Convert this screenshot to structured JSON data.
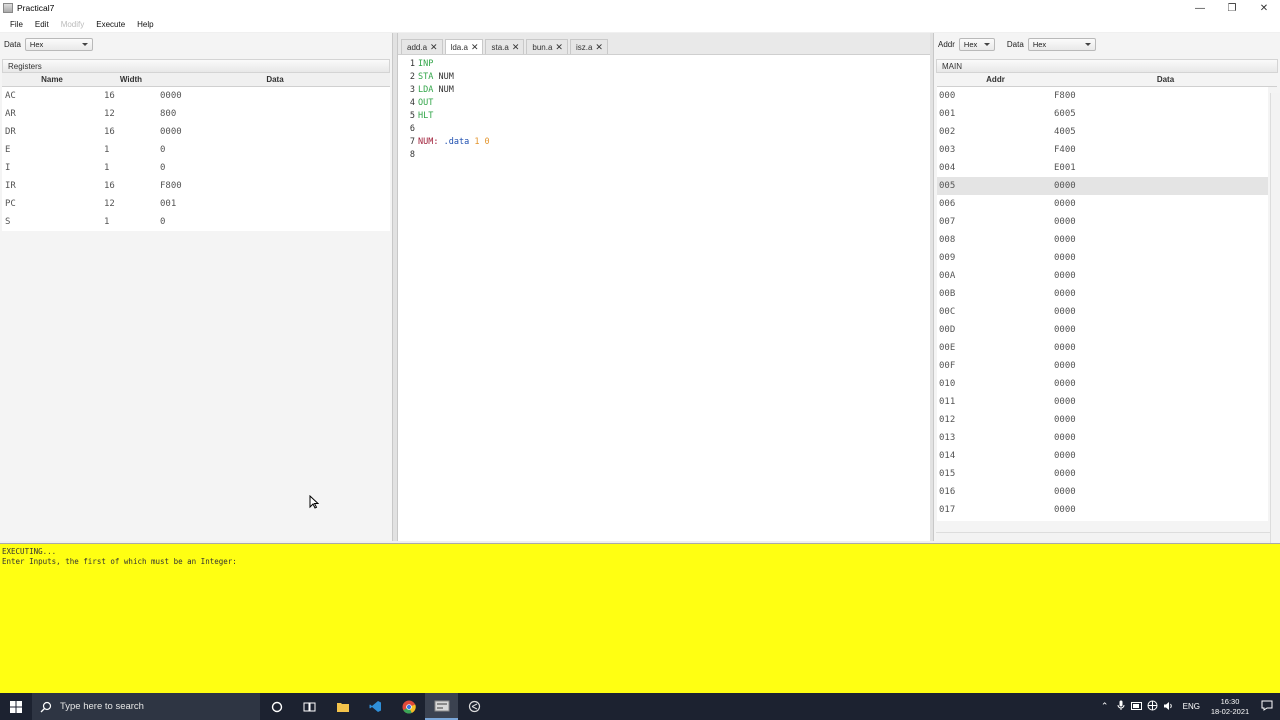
{
  "window": {
    "title": "Practical7",
    "controls": [
      "—",
      "❐",
      "✕"
    ]
  },
  "menu": [
    {
      "label": "File",
      "enabled": true
    },
    {
      "label": "Edit",
      "enabled": true
    },
    {
      "label": "Modify",
      "enabled": false
    },
    {
      "label": "Execute",
      "enabled": true
    },
    {
      "label": "Help",
      "enabled": true
    }
  ],
  "registers_panel": {
    "data_label": "Data",
    "data_format": "Hex",
    "section_title": "Registers",
    "columns": [
      "Name",
      "Width",
      "Data"
    ],
    "rows": [
      {
        "name": "AC",
        "width": "16",
        "data": "0000"
      },
      {
        "name": "AR",
        "width": "12",
        "data": "800"
      },
      {
        "name": "DR",
        "width": "16",
        "data": "0000"
      },
      {
        "name": "E",
        "width": "1",
        "data": "0"
      },
      {
        "name": "I",
        "width": "1",
        "data": "0"
      },
      {
        "name": "IR",
        "width": "16",
        "data": "F800"
      },
      {
        "name": "PC",
        "width": "12",
        "data": "001"
      },
      {
        "name": "S",
        "width": "1",
        "data": "0"
      }
    ]
  },
  "editor": {
    "tabs": [
      {
        "label": "add.a",
        "active": false
      },
      {
        "label": "lda.a",
        "active": true
      },
      {
        "label": "sta.a",
        "active": false
      },
      {
        "label": "bun.a",
        "active": false
      },
      {
        "label": "isz.a",
        "active": false
      }
    ],
    "lines": [
      {
        "n": "1",
        "parts": [
          {
            "t": "INP",
            "c": "kw"
          }
        ]
      },
      {
        "n": "2",
        "parts": [
          {
            "t": "STA",
            "c": "kw"
          },
          {
            "t": " NUM",
            "c": "ident"
          }
        ]
      },
      {
        "n": "3",
        "parts": [
          {
            "t": "LDA",
            "c": "kw"
          },
          {
            "t": " NUM",
            "c": "ident"
          }
        ]
      },
      {
        "n": "4",
        "parts": [
          {
            "t": "OUT",
            "c": "kw"
          }
        ]
      },
      {
        "n": "5",
        "parts": [
          {
            "t": "HLT",
            "c": "kw"
          }
        ]
      },
      {
        "n": "6",
        "parts": []
      },
      {
        "n": "7",
        "parts": [
          {
            "t": "NUM:",
            "c": "lbl"
          },
          {
            "t": " .data",
            "c": "dir"
          },
          {
            "t": " 1 0",
            "c": "num"
          }
        ]
      },
      {
        "n": "8",
        "parts": []
      }
    ]
  },
  "memory_panel": {
    "addr_label": "Addr",
    "addr_format": "Hex",
    "data_label": "Data",
    "data_format": "Hex",
    "section_title": "MAIN",
    "columns": [
      "Addr",
      "Data"
    ],
    "rows": [
      {
        "addr": "000",
        "data": "F800"
      },
      {
        "addr": "001",
        "data": "6005"
      },
      {
        "addr": "002",
        "data": "4005"
      },
      {
        "addr": "003",
        "data": "F400"
      },
      {
        "addr": "004",
        "data": "E001"
      },
      {
        "addr": "005",
        "data": "0000",
        "selected": true
      },
      {
        "addr": "006",
        "data": "0000"
      },
      {
        "addr": "007",
        "data": "0000"
      },
      {
        "addr": "008",
        "data": "0000"
      },
      {
        "addr": "009",
        "data": "0000"
      },
      {
        "addr": "00A",
        "data": "0000"
      },
      {
        "addr": "00B",
        "data": "0000"
      },
      {
        "addr": "00C",
        "data": "0000"
      },
      {
        "addr": "00D",
        "data": "0000"
      },
      {
        "addr": "00E",
        "data": "0000"
      },
      {
        "addr": "00F",
        "data": "0000"
      },
      {
        "addr": "010",
        "data": "0000"
      },
      {
        "addr": "011",
        "data": "0000"
      },
      {
        "addr": "012",
        "data": "0000"
      },
      {
        "addr": "013",
        "data": "0000"
      },
      {
        "addr": "014",
        "data": "0000"
      },
      {
        "addr": "015",
        "data": "0000"
      },
      {
        "addr": "016",
        "data": "0000"
      },
      {
        "addr": "017",
        "data": "0000"
      }
    ]
  },
  "console": {
    "lines": [
      "EXECUTING...",
      "Enter Inputs, the first of which must be an Integer:"
    ],
    "background": "#ffff12"
  },
  "taskbar": {
    "search_placeholder": "Type here to search",
    "apps": [
      "cortana-icon",
      "task-view-icon",
      "file-explorer-icon",
      "vscode-icon",
      "chrome-icon",
      "simulator-app-icon",
      "app-icon"
    ],
    "language": "ENG",
    "time": "16:30",
    "date": "18-02-2021"
  }
}
